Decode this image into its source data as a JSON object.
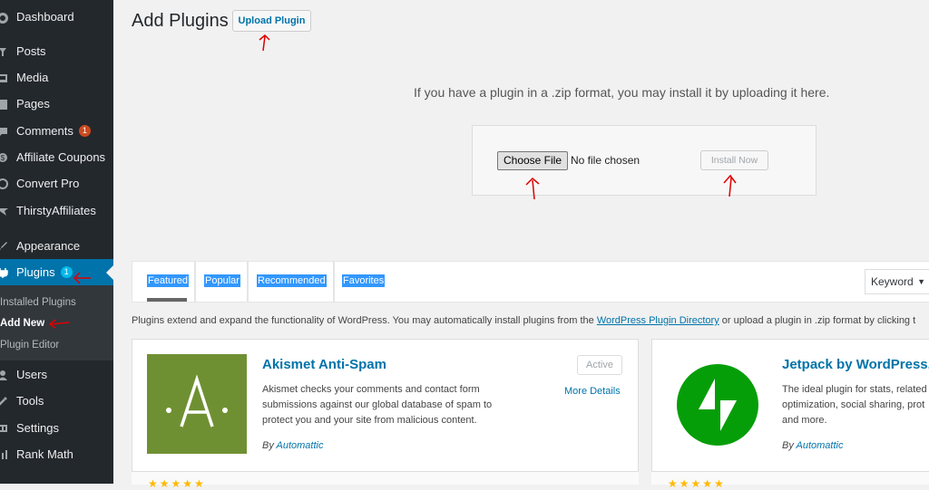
{
  "sidebar": {
    "items": [
      {
        "label": "Dashboard",
        "icon": "dashboard-icon"
      },
      {
        "label": "Posts",
        "icon": "pin-icon"
      },
      {
        "label": "Media",
        "icon": "media-icon"
      },
      {
        "label": "Pages",
        "icon": "pages-icon"
      },
      {
        "label": "Comments",
        "icon": "comment-icon",
        "badge": "1"
      },
      {
        "label": "Affiliate Coupons",
        "icon": "coupon-icon"
      },
      {
        "label": "Convert Pro",
        "icon": "convert-icon"
      },
      {
        "label": "ThirstyAffiliates",
        "icon": "thirsty-icon"
      },
      {
        "label": "Appearance",
        "icon": "brush-icon"
      },
      {
        "label": "Plugins",
        "icon": "plugin-icon",
        "badge": "1"
      },
      {
        "label": "Users",
        "icon": "users-icon"
      },
      {
        "label": "Tools",
        "icon": "tools-icon"
      },
      {
        "label": "Settings",
        "icon": "settings-icon"
      },
      {
        "label": "Rank Math",
        "icon": "rankmath-icon"
      }
    ],
    "submenu": [
      {
        "label": "Installed Plugins"
      },
      {
        "label": "Add New"
      },
      {
        "label": "Plugin Editor"
      }
    ]
  },
  "header": {
    "title": "Add Plugins",
    "upload_button": "Upload Plugin"
  },
  "upload": {
    "description": "If you have a plugin in a .zip format, you may install it by uploading it here.",
    "choose_file": "Choose File",
    "no_file": "No file chosen",
    "install_now": "Install Now"
  },
  "filter": {
    "tabs": [
      {
        "label": "Featured"
      },
      {
        "label": "Popular"
      },
      {
        "label": "Recommended"
      },
      {
        "label": "Favorites"
      }
    ],
    "search_type": "Keyword"
  },
  "intro": {
    "text_before": "Plugins extend and expand the functionality of WordPress. You may automatically install plugins from the ",
    "link": "WordPress Plugin Directory",
    "text_after": " or upload a plugin in .zip format by clicking t"
  },
  "plugins": [
    {
      "name": "Akismet Anti-Spam",
      "description": "Akismet checks your comments and contact form submissions against our global database of spam to protect you and your site from malicious content.",
      "by": "By",
      "author": "Automattic",
      "status": "Active",
      "more": "More Details",
      "icon_letter": "·A·",
      "stars": "★★★★★"
    },
    {
      "name": "Jetpack by WordPress.c",
      "description": "The ideal plugin for stats, related optimization, social sharing, prot and more.",
      "by": "By",
      "author": "Automattic",
      "stars": "★★★★★"
    }
  ],
  "colors": {
    "sidebar_bg": "#23282d",
    "active_menu": "#0073aa",
    "link": "#0073aa",
    "badge": "#ca4a1f",
    "akismet_green": "#6f9032",
    "jetpack_green": "#069e08",
    "annotation": "#e00000"
  }
}
